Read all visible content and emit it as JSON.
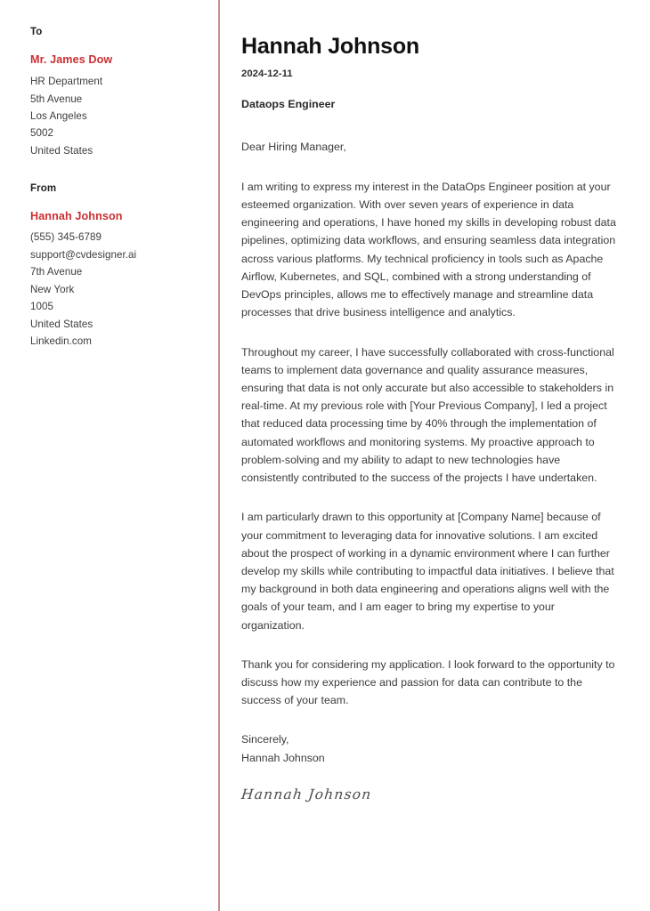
{
  "accent_color": "#cc2f31",
  "divider_color": "#c98d90",
  "recipient": {
    "label": "To",
    "name": "Mr. James Dow",
    "lines": [
      "HR Department",
      "5th Avenue",
      "Los Angeles",
      "5002",
      "United States"
    ]
  },
  "sender": {
    "label": "From",
    "name": "Hannah Johnson",
    "lines": [
      "(555) 345-6789",
      "support@cvdesigner.ai",
      "7th Avenue",
      "New York",
      "1005",
      "United States",
      "Linkedin.com"
    ]
  },
  "letter": {
    "name": "Hannah Johnson",
    "date": "2024-12-11",
    "role": "Dataops Engineer",
    "salutation": "Dear Hiring Manager,",
    "paragraphs": [
      "I am writing to express my interest in the DataOps Engineer position at your esteemed organization. With over seven years of experience in data engineering and operations, I have honed my skills in developing robust data pipelines, optimizing data workflows, and ensuring seamless data integration across various platforms. My technical proficiency in tools such as Apache Airflow, Kubernetes, and SQL, combined with a strong understanding of DevOps principles, allows me to effectively manage and streamline data processes that drive business intelligence and analytics.",
      "Throughout my career, I have successfully collaborated with cross-functional teams to implement data governance and quality assurance measures, ensuring that data is not only accurate but also accessible to stakeholders in real-time. At my previous role with [Your Previous Company], I led a project that reduced data processing time by 40% through the implementation of automated workflows and monitoring systems. My proactive approach to problem-solving and my ability to adapt to new technologies have consistently contributed to the success of the projects I have undertaken.",
      "I am particularly drawn to this opportunity at [Company Name] because of your commitment to leveraging data for innovative solutions. I am excited about the prospect of working in a dynamic environment where I can further develop my skills while contributing to impactful data initiatives. I believe that my background in both data engineering and operations aligns well with the goals of your team, and I am eager to bring my expertise to your organization.",
      "Thank you for considering my application. I look forward to the opportunity to discuss how my experience and passion for data can contribute to the success of your team."
    ],
    "closing_word": "Sincerely,",
    "closing_name": "Hannah Johnson",
    "signature": "Hannah Johnson"
  }
}
